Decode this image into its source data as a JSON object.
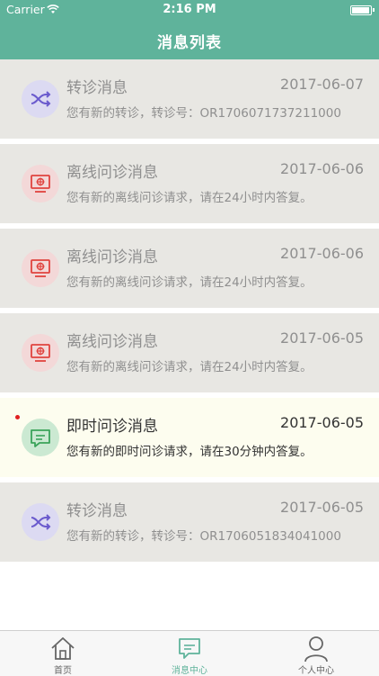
{
  "status_bar": {
    "carrier": "Carrier",
    "time": "2:16 PM"
  },
  "nav": {
    "title": "消息列表"
  },
  "messages": [
    {
      "title": "转诊消息",
      "date": "2017-06-07",
      "desc": "您有新的转诊，转诊号：OR1706071737211000",
      "icon": "transfer-icon",
      "unread": false
    },
    {
      "title": "离线问诊消息",
      "date": "2017-06-06",
      "desc": "您有新的离线问诊请求，请在24小时内答复。",
      "icon": "monitor-icon",
      "unread": false
    },
    {
      "title": "离线问诊消息",
      "date": "2017-06-06",
      "desc": "您有新的离线问诊请求，请在24小时内答复。",
      "icon": "monitor-icon",
      "unread": false
    },
    {
      "title": "离线问诊消息",
      "date": "2017-06-05",
      "desc": "您有新的离线问诊请求，请在24小时内答复。",
      "icon": "monitor-icon",
      "unread": false
    },
    {
      "title": "即时问诊消息",
      "date": "2017-06-05",
      "desc": "您有新的即时问诊请求，请在30分钟内答复。",
      "icon": "chat-icon",
      "unread": true
    },
    {
      "title": "转诊消息",
      "date": "2017-06-05",
      "desc": "您有新的转诊，转诊号：OR1706051834041000",
      "icon": "transfer-icon",
      "unread": false
    }
  ],
  "tabbar": {
    "tabs": [
      {
        "label": "首页",
        "icon": "home-icon"
      },
      {
        "label": "消息中心",
        "icon": "message-center-icon",
        "active": true
      },
      {
        "label": "个人中心",
        "icon": "person-icon"
      }
    ]
  },
  "colors": {
    "accent": "#5fb39b",
    "unread_dot": "#e02020",
    "transfer_icon": "#6a5acd",
    "offline_icon": "#e0433f",
    "instant_icon": "#3aa35a"
  }
}
